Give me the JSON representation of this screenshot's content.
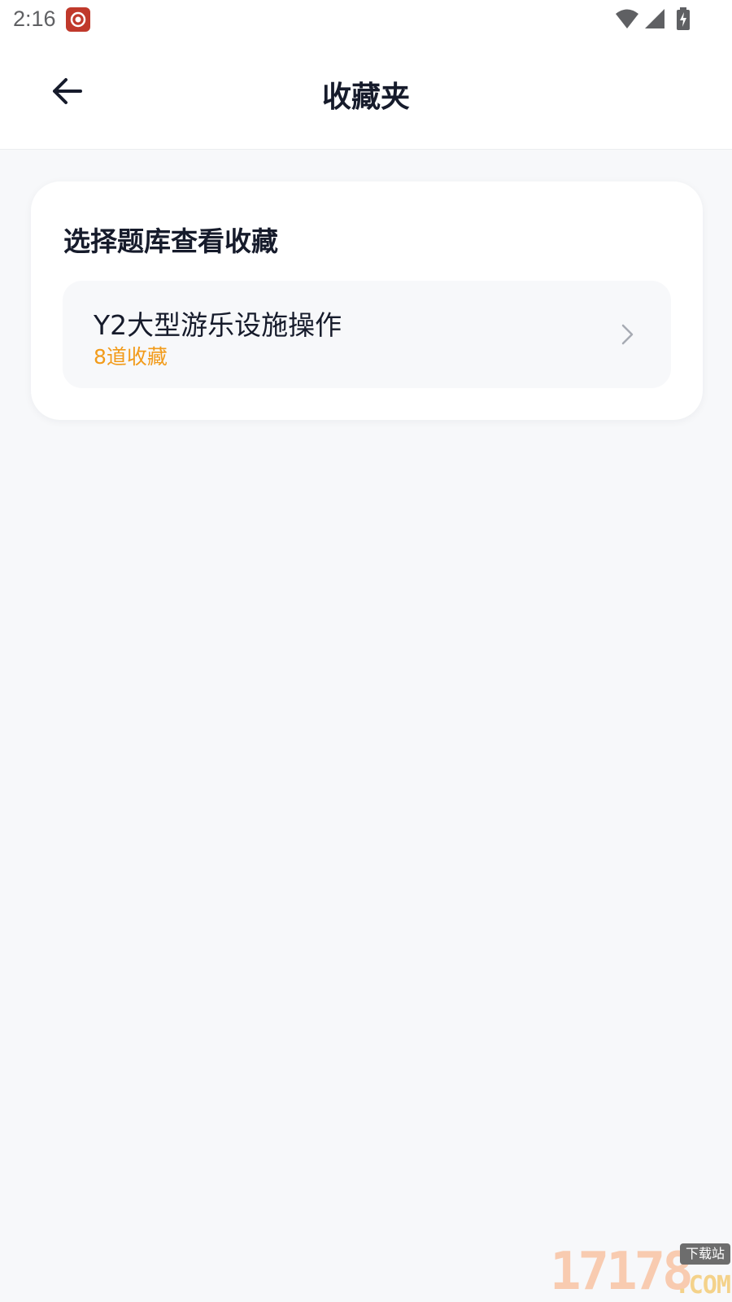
{
  "status_bar": {
    "time": "2:16",
    "icons": [
      "app-notification-icon",
      "wifi-icon",
      "cellular-signal-icon",
      "battery-charging-icon"
    ]
  },
  "header": {
    "title": "收藏夹",
    "back_icon": "arrow-left-icon"
  },
  "main": {
    "section_title": "选择题库查看收藏",
    "question_banks": [
      {
        "name": "Y2大型游乐设施操作",
        "count_label": "8道收藏"
      }
    ]
  },
  "watermark": {
    "digits": "17178",
    "badge": "下载站",
    "suffix": ".COM"
  },
  "colors": {
    "page_background": "#f7f8fa",
    "card_background": "#ffffff",
    "primary_text": "#161b2b",
    "accent_count": "#f29b1a",
    "chevron": "#a7abb3"
  }
}
